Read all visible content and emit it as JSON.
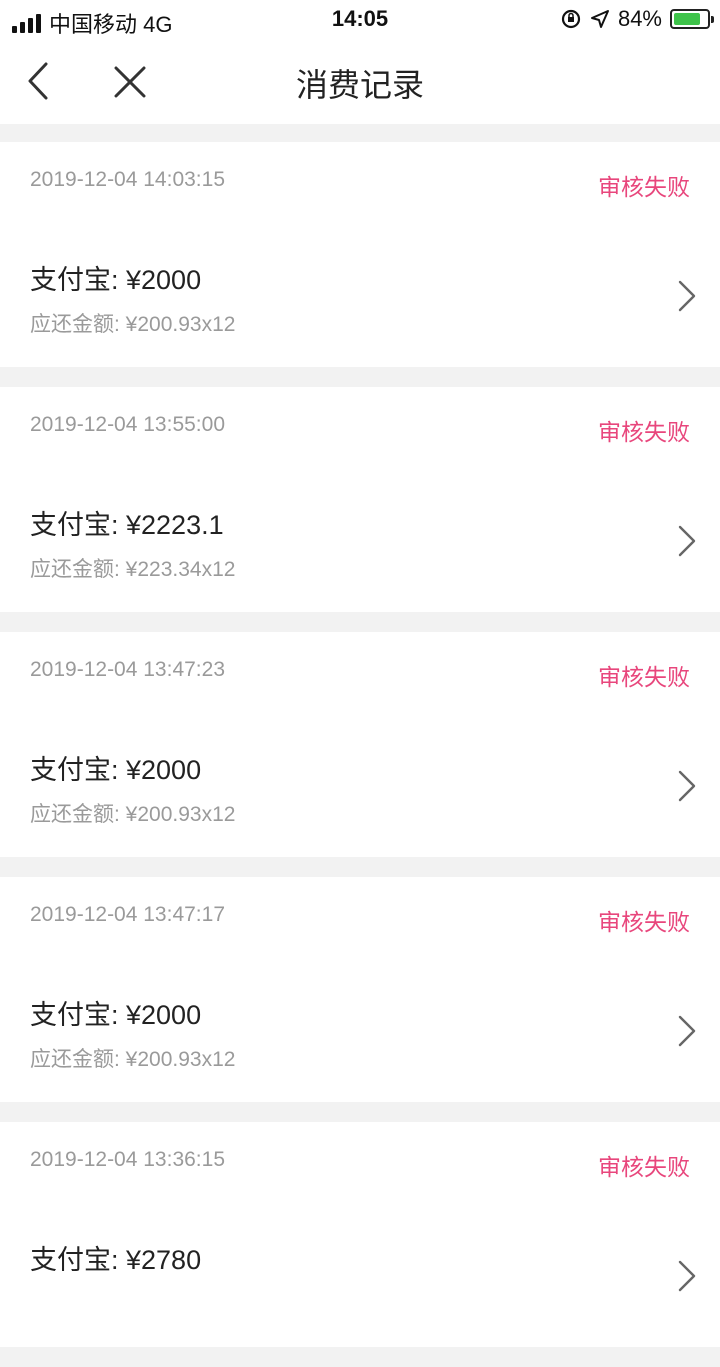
{
  "status_bar": {
    "carrier": "中国移动 4G",
    "time": "14:05",
    "battery_pct": "84%",
    "icons": [
      "signal-icon",
      "rotation-lock-icon",
      "location-icon",
      "battery-charging-icon"
    ]
  },
  "nav": {
    "title": "消费记录",
    "back_icon": "chevron-left-icon",
    "close_icon": "close-icon"
  },
  "colors": {
    "status_failed": "#e8467c",
    "muted_text": "#9a9a9a",
    "background": "#f2f2f2"
  },
  "records": [
    {
      "time": "2019-12-04 14:03:15",
      "status": "审核失败",
      "amount": "支付宝: ¥2000",
      "repay": "应还金额: ¥200.93x12"
    },
    {
      "time": "2019-12-04 13:55:00",
      "status": "审核失败",
      "amount": "支付宝: ¥2223.1",
      "repay": "应还金额: ¥223.34x12"
    },
    {
      "time": "2019-12-04 13:47:23",
      "status": "审核失败",
      "amount": "支付宝: ¥2000",
      "repay": "应还金额: ¥200.93x12"
    },
    {
      "time": "2019-12-04 13:47:17",
      "status": "审核失败",
      "amount": "支付宝: ¥2000",
      "repay": "应还金额: ¥200.93x12"
    },
    {
      "time": "2019-12-04 13:36:15",
      "status": "审核失败",
      "amount": "支付宝: ¥2780",
      "repay": ""
    }
  ]
}
